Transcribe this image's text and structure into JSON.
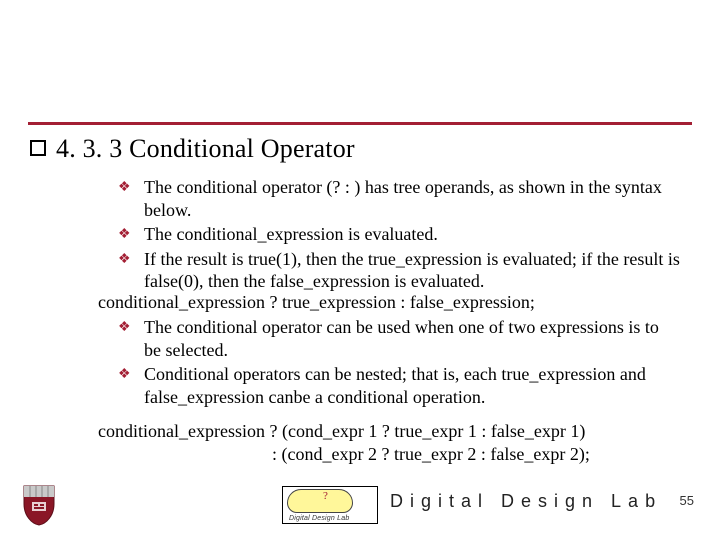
{
  "title": "4. 3. 3 Conditional Operator",
  "bullets1": [
    "The conditional operator (? : ) has tree operands, as shown in the syntax below.",
    "The conditional_expression is evaluated.",
    "If the result is true(1), then the true_expression is evaluated; if the result is false(0), then the false_expression is evaluated."
  ],
  "code1": "conditional_expression ? true_expression : false_expression;",
  "bullets2": [
    "The conditional operator can be used when one of two expressions is to be selected.",
    "Conditional operators can be nested; that is, each true_expression and false_expression canbe a conditional operation."
  ],
  "code2_line1": "conditional_expression ? (cond_expr 1 ? true_expr 1 : false_expr 1)",
  "code2_line2": ": (cond_expr 2 ? true_expr 2 : false_expr 2);",
  "footer": {
    "logo_caption": "Digital Design Lab",
    "lab_text": "Digital Design Lab",
    "page": "55"
  }
}
